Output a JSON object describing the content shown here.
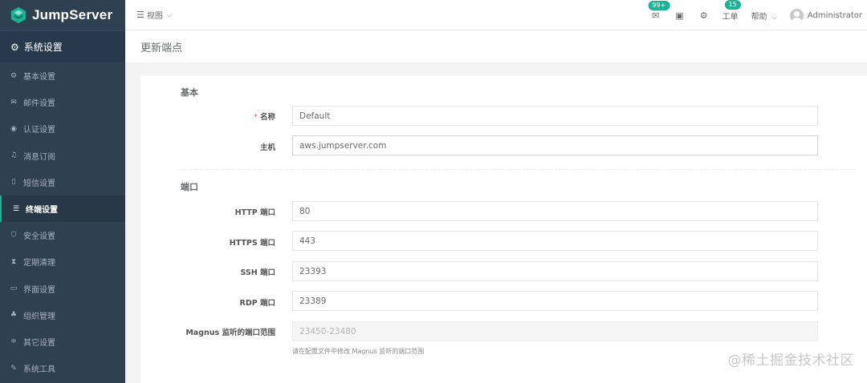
{
  "app": {
    "name": "JumpServer"
  },
  "sidebar": {
    "section_title": "系统设置",
    "items": [
      {
        "label": "基本设置",
        "icon": "gear-icon"
      },
      {
        "label": "邮件设置",
        "icon": "envelope-icon"
      },
      {
        "label": "认证设置",
        "icon": "user-circle-icon"
      },
      {
        "label": "消息订阅",
        "icon": "bell-icon"
      },
      {
        "label": "短信设置",
        "icon": "mobile-icon"
      },
      {
        "label": "终端设置",
        "icon": "bars-icon"
      },
      {
        "label": "安全设置",
        "icon": "shield-icon"
      },
      {
        "label": "定期清理",
        "icon": "hourglass-icon"
      },
      {
        "label": "界面设置",
        "icon": "laptop-icon"
      },
      {
        "label": "组织管理",
        "icon": "sitemap-icon"
      },
      {
        "label": "其它设置",
        "icon": "sliders-icon"
      },
      {
        "label": "系统工具",
        "icon": "wrench-icon"
      }
    ],
    "active_index": 5
  },
  "header": {
    "view_label": "视图",
    "mail_badge": "99+",
    "ticket_label": "工单",
    "ticket_badge": "15",
    "help_label": "帮助",
    "user_name": "Administrator"
  },
  "page": {
    "title": "更新端点"
  },
  "form": {
    "basic_section": "基本",
    "name_label": "名称",
    "name_value": "Default",
    "host_label": "主机",
    "host_value": "aws.jumpserver.com",
    "port_section": "端口",
    "http_label": "HTTP 端口",
    "http_value": "80",
    "https_label": "HTTPS 端口",
    "https_value": "443",
    "ssh_label": "SSH 端口",
    "ssh_value": "23393",
    "rdp_label": "RDP 端口",
    "rdp_value": "23389",
    "magnus_label": "Magnus 监听的端口范围",
    "magnus_value": "23450-23480",
    "magnus_help": "请在配置文件中修改 Magnus 监听的端口范围"
  },
  "watermark": "@稀土掘金技术社区",
  "colors": {
    "sidebar_bg": "#2f4050",
    "accent": "#1ab394",
    "required": "#ed5565"
  }
}
